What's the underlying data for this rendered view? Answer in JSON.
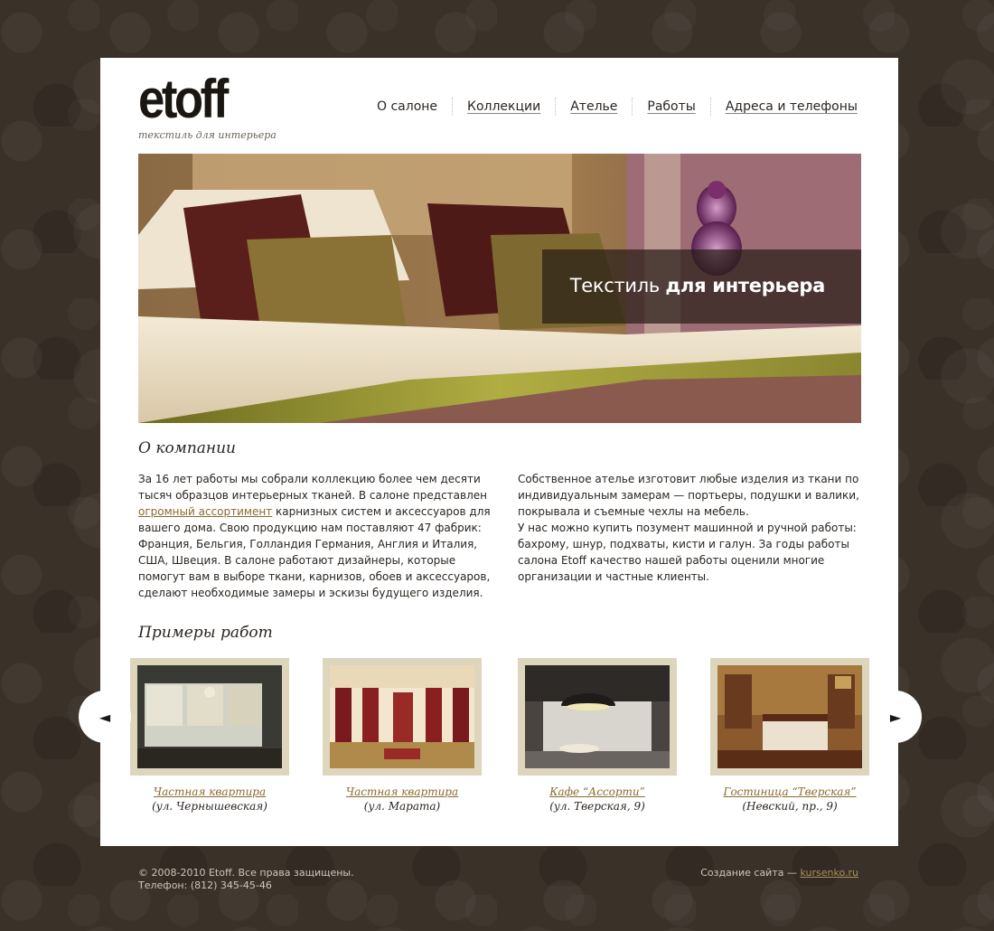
{
  "brand": {
    "logo": "etoff",
    "tagline": "текстиль для интерьера"
  },
  "nav": [
    {
      "label": "О салоне",
      "link": false
    },
    {
      "label": "Коллекции",
      "link": true
    },
    {
      "label": "Ателье",
      "link": true
    },
    {
      "label": "Работы",
      "link": true
    },
    {
      "label": "Адреса и телефоны",
      "link": true
    }
  ],
  "banner": {
    "caption_light": "Текстиль ",
    "caption_bold": "для интерьера"
  },
  "about": {
    "title": "О компании",
    "col1_part1": "За 16 лет работы мы собрали коллекцию более чем десяти тысяч образцов интерьерных тканей. В салоне представлен ",
    "col1_link": "огромный ассортимент",
    "col1_part2": " карнизных систем и аксессуаров для вашего дома. Свою продукцию нам поставляют 47 фабрик: Франция, Бельгия, Голландия Германия, Англия и Италия, США, Швеция. В салоне работают дизайнеры, которые помогут вам в выборе ткани, карнизов, обоев и аксессуаров, сделают необходимые замеры и эскизы будущего изделия.",
    "col2_p1": "Собственное ателье изготовит любые изделия из ткани по индивидуальным замерам — портьеры, подушки и валики, покрывала и съемные чехлы на мебель.",
    "col2_p2": "У нас можно купить позумент машинной и ручной работы: бахрому, шнур, подхваты, кисти и галун. За годы работы салона Etoff качество нашей работы оценили многие организации и частные клиенты."
  },
  "works": {
    "title": "Примеры работ",
    "prev_icon": "◄",
    "next_icon": "►",
    "items": [
      {
        "name": "Частная квартира",
        "address": "(ул. Чернышевская)"
      },
      {
        "name": "Частная квартира",
        "address": "(ул. Марата)"
      },
      {
        "name": "Кафе “Ассорти”",
        "address": "(ул. Тверская, 9)"
      },
      {
        "name": "Гостиница “Тверская”",
        "address": "(Невский, пр., 9)"
      }
    ]
  },
  "footer": {
    "copyright": "© 2008-2010 Etoff. Все права защищены.",
    "phone": "Телефон: (812) 345-45-46",
    "credit_label": "Создание сайта — ",
    "credit_link": "kursenko.ru"
  }
}
